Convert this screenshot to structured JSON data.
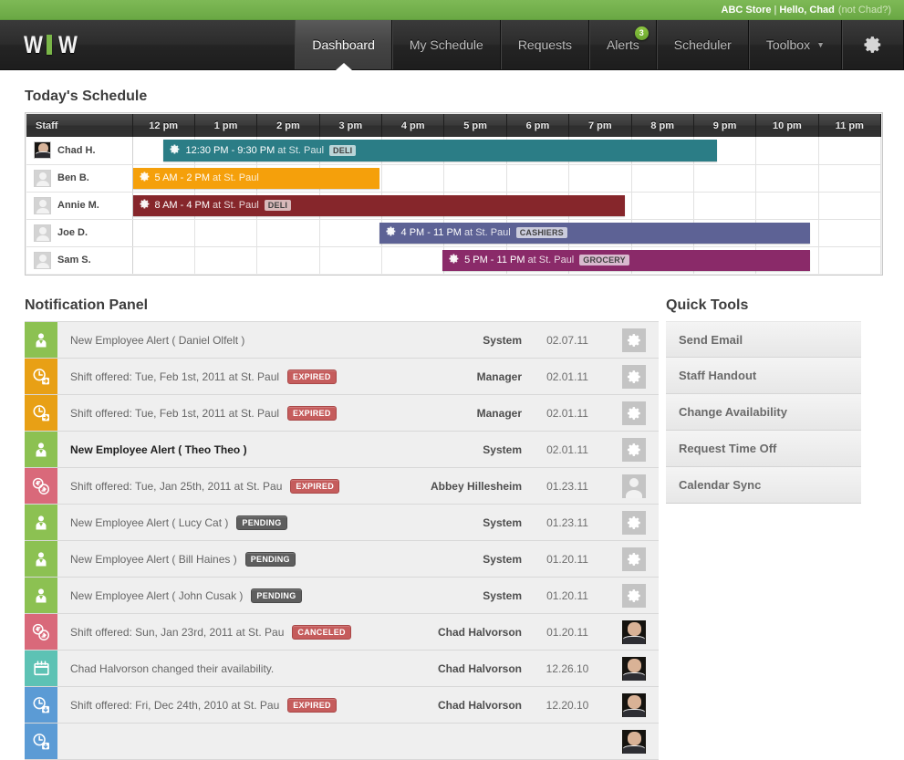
{
  "topbar": {
    "store": "ABC Store",
    "separator": "|",
    "greeting": "Hello, Chad",
    "not_you": "(not Chad?)"
  },
  "nav": {
    "logo_text": "WIW",
    "items": [
      {
        "label": "Dashboard",
        "active": true,
        "badge": null,
        "caret": false
      },
      {
        "label": "My Schedule",
        "active": false,
        "badge": null,
        "caret": false
      },
      {
        "label": "Requests",
        "active": false,
        "badge": null,
        "caret": false
      },
      {
        "label": "Alerts",
        "active": false,
        "badge": "3",
        "caret": false
      },
      {
        "label": "Scheduler",
        "active": false,
        "badge": null,
        "caret": false
      },
      {
        "label": "Toolbox",
        "active": false,
        "badge": null,
        "caret": true
      }
    ],
    "settings_icon": "gear-icon",
    "caret_glyph": "▼"
  },
  "schedule": {
    "title": "Today's Schedule",
    "staff_header": "Staff",
    "hours": [
      "12 pm",
      "1 pm",
      "2 pm",
      "3 pm",
      "4 pm",
      "5 pm",
      "6 pm",
      "7 pm",
      "8 pm",
      "9 pm",
      "10 pm",
      "11 pm"
    ],
    "rows": [
      {
        "name": "Chad H.",
        "avatar": "photo",
        "shift": {
          "time": "12:30 PM - 9:30 PM",
          "location": "at St. Paul",
          "dept": "DELI",
          "color": "#2b7d86",
          "left_pct": 4.2,
          "width_pct": 75.0
        }
      },
      {
        "name": "Ben B.",
        "avatar": "generic",
        "shift": {
          "time": "5 AM - 2 PM",
          "location": "at St. Paul",
          "dept": null,
          "color": "#f5a00b",
          "left_pct": 0,
          "width_pct": 33.4
        }
      },
      {
        "name": "Annie M.",
        "avatar": "generic",
        "shift": {
          "time": "8 AM - 4 PM",
          "location": "at St. Paul",
          "dept": "DELI",
          "color": "#86262b",
          "left_pct": 0,
          "width_pct": 66.7
        }
      },
      {
        "name": "Joe D.",
        "avatar": "generic",
        "shift": {
          "time": "4 PM - 11 PM",
          "location": "at St. Paul",
          "dept": "CASHIERS",
          "color": "#5d6295",
          "left_pct": 33.4,
          "width_pct": 58.4
        }
      },
      {
        "name": "Sam S.",
        "avatar": "generic",
        "shift": {
          "time": "5 PM - 11 PM",
          "location": "at St. Paul",
          "dept": "GROCERY",
          "color": "#8a2a69",
          "left_pct": 42.0,
          "width_pct": 49.8
        }
      }
    ]
  },
  "notifications": {
    "title": "Notification Panel",
    "rows": [
      {
        "icon": "new-employee-icon",
        "icon_color": "#8cc152",
        "text": "New Employee Alert ( Daniel Olfelt )",
        "badge": null,
        "from": "System",
        "date": "02.07.11",
        "thumb": "gear",
        "unread": false
      },
      {
        "icon": "shift-offered-icon",
        "icon_color": "#e8a015",
        "text": "Shift offered: Tue, Feb 1st, 2011 at St. Paul",
        "badge": "EXPIRED",
        "badge_kind": "expired",
        "from": "Manager",
        "date": "02.01.11",
        "thumb": "gear",
        "unread": false
      },
      {
        "icon": "shift-offered-icon",
        "icon_color": "#e8a015",
        "text": "Shift offered: Tue, Feb 1st, 2011 at St. Paul",
        "badge": "EXPIRED",
        "badge_kind": "expired",
        "from": "Manager",
        "date": "02.01.11",
        "thumb": "gear",
        "unread": false
      },
      {
        "icon": "new-employee-icon",
        "icon_color": "#8cc152",
        "text": "New Employee Alert ( Theo Theo )",
        "badge": null,
        "from": "System",
        "date": "02.01.11",
        "thumb": "gear",
        "unread": true
      },
      {
        "icon": "shift-trade-icon",
        "icon_color": "#d9697a",
        "text": "Shift offered: Tue, Jan 25th, 2011 at St. Pau",
        "badge": "EXPIRED",
        "badge_kind": "expired",
        "from": "Abbey Hillesheim",
        "date": "01.23.11",
        "thumb": "person",
        "unread": false
      },
      {
        "icon": "new-employee-icon",
        "icon_color": "#8cc152",
        "text": "New Employee Alert ( Lucy Cat )",
        "badge": "PENDING",
        "badge_kind": "pending",
        "from": "System",
        "date": "01.23.11",
        "thumb": "gear",
        "unread": false
      },
      {
        "icon": "new-employee-icon",
        "icon_color": "#8cc152",
        "text": "New Employee Alert ( Bill Haines )",
        "badge": "PENDING",
        "badge_kind": "pending",
        "from": "System",
        "date": "01.20.11",
        "thumb": "gear",
        "unread": false
      },
      {
        "icon": "new-employee-icon",
        "icon_color": "#8cc152",
        "text": "New Employee Alert ( John Cusak )",
        "badge": "PENDING",
        "badge_kind": "pending",
        "from": "System",
        "date": "01.20.11",
        "thumb": "gear",
        "unread": false
      },
      {
        "icon": "shift-trade-icon",
        "icon_color": "#d9697a",
        "text": "Shift offered: Sun, Jan 23rd, 2011 at St. Pau",
        "badge": "CANCELED",
        "badge_kind": "canceled",
        "from": "Chad Halvorson",
        "date": "01.20.11",
        "thumb": "photo",
        "unread": false
      },
      {
        "icon": "calendar-icon",
        "icon_color": "#5dc2b4",
        "text": "Chad Halvorson changed their availability.",
        "badge": null,
        "from": "Chad Halvorson",
        "date": "12.26.10",
        "thumb": "photo",
        "unread": false
      },
      {
        "icon": "shift-taken-icon",
        "icon_color": "#5b9bd5",
        "text": "Shift offered: Fri, Dec 24th, 2010 at St. Pau",
        "badge": "EXPIRED",
        "badge_kind": "expired",
        "from": "Chad Halvorson",
        "date": "12.20.10",
        "thumb": "photo",
        "unread": false
      },
      {
        "icon": "shift-taken-icon",
        "icon_color": "#5b9bd5",
        "text": "",
        "badge": null,
        "from": "",
        "date": "",
        "thumb": "photo",
        "unread": false
      }
    ]
  },
  "quick_tools": {
    "title": "Quick Tools",
    "buttons": [
      "Send Email",
      "Staff Handout",
      "Change Availability",
      "Request Time Off",
      "Calendar Sync"
    ]
  }
}
